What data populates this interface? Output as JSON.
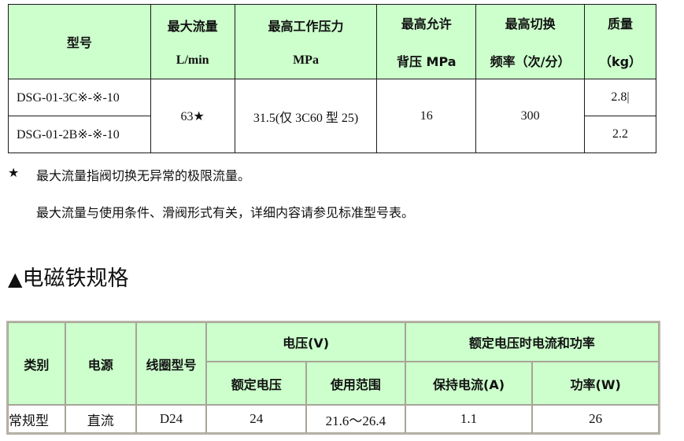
{
  "spec_table": {
    "headers": [
      {
        "line1": "型号",
        "line2": ""
      },
      {
        "line1": "最大流量",
        "line2": "L/min"
      },
      {
        "line1": "最高工作压力",
        "line2": "MPa"
      },
      {
        "line1": "最高允许",
        "line2": "背压 MPa"
      },
      {
        "line1": "最高切换",
        "line2": "频率（次/分）"
      },
      {
        "line1": "质量",
        "line2": "（kg）"
      }
    ],
    "rows": [
      {
        "model": "DSG-01-3C※-※-10",
        "mass": "2.8|"
      },
      {
        "model": "DSG-01-2B※-※-10",
        "mass": "2.2"
      }
    ],
    "shared": {
      "max_flow": "63★",
      "max_pressure": "31.5(仅 3C60 型 25)",
      "back_pressure": "16",
      "switch_freq": "300"
    }
  },
  "notes": {
    "star_symbol": "★",
    "note1": "最大流量指阀切换无异常的极限流量。",
    "note2": "最大流量与使用条件、滑阀形式有关，详细内容请参见标准型号表。"
  },
  "section": {
    "icon": "▲",
    "title": "电磁铁规格"
  },
  "solenoid_table": {
    "headers": {
      "category": "类别",
      "power_source": "电源",
      "coil_model": "线圈型号",
      "voltage_group": "电压(V)",
      "rated_voltage": "额定电压",
      "usage_range": "使用范围",
      "current_power_group": "额定电压时电流和功率",
      "holding_current": "保持电流(A)",
      "power": "功率(W)"
    },
    "rows": [
      {
        "category": "常规型",
        "power_source": "直流",
        "coil_model": "D24",
        "rated_voltage": "24",
        "usage_range": "21.6～26.4",
        "holding_current": "1.1",
        "power": "26"
      }
    ]
  }
}
